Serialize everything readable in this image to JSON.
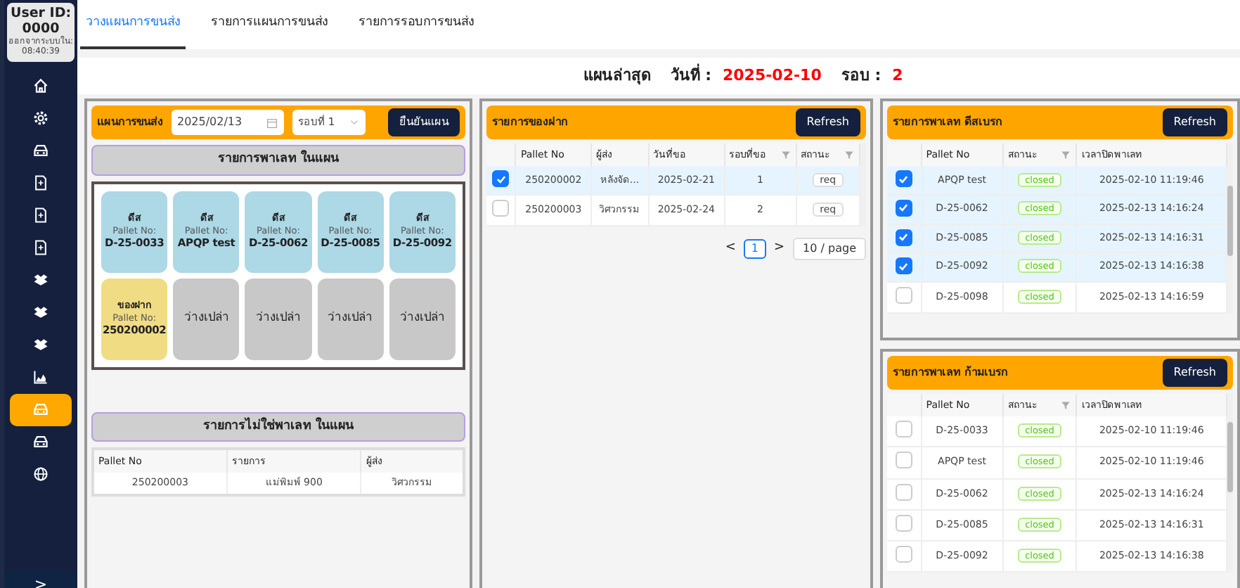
{
  "sidebar": {
    "user_label": "User ID:",
    "user_id": "0000",
    "logout_label": "ออกจากระบบใน:",
    "logout_time": "08:40:39",
    "items": [
      {
        "kind": "home",
        "selected": false
      },
      {
        "kind": "gear",
        "selected": false
      },
      {
        "kind": "car",
        "selected": false
      },
      {
        "kind": "doc",
        "selected": false
      },
      {
        "kind": "doc",
        "selected": false
      },
      {
        "kind": "doc",
        "selected": false
      },
      {
        "kind": "box",
        "selected": false
      },
      {
        "kind": "box",
        "selected": false
      },
      {
        "kind": "box",
        "selected": false
      },
      {
        "kind": "chart",
        "selected": false
      },
      {
        "kind": "car",
        "selected": true
      },
      {
        "kind": "car",
        "selected": false
      },
      {
        "kind": "globe",
        "selected": false
      }
    ],
    "expand": ">"
  },
  "tabs": [
    {
      "label": "วางแผนการขนส่ง",
      "selected": true
    },
    {
      "label": "รายการแผนการขนส่ง",
      "selected": false
    },
    {
      "label": "รายการรอบการขนส่ง",
      "selected": false
    }
  ],
  "header": {
    "label": "แผนล่าสุด",
    "date_label": "วันที่ :",
    "date": "2025-02-10",
    "round_label": "รอบ :",
    "round": "2"
  },
  "plan_panel": {
    "label": "แผนการขนส่ง",
    "date": "2025/02/13",
    "round_select": "รอบที่ 1",
    "confirm_button": "ยืนยันแผน",
    "pallet_title": "รายการพาเลท ในแผน",
    "pallets": [
      {
        "kind": "pallet",
        "type": "ดีส",
        "pallet_label": "Pallet No:",
        "pallet_no": "D-25-0033"
      },
      {
        "kind": "pallet",
        "type": "ดีส",
        "pallet_label": "Pallet No:",
        "pallet_no": "APQP test"
      },
      {
        "kind": "pallet",
        "type": "ดีส",
        "pallet_label": "Pallet No:",
        "pallet_no": "D-25-0062"
      },
      {
        "kind": "pallet",
        "type": "ดีส",
        "pallet_label": "Pallet No:",
        "pallet_no": "D-25-0085"
      },
      {
        "kind": "pallet",
        "type": "ดีส",
        "pallet_label": "Pallet No:",
        "pallet_no": "D-25-0092"
      },
      {
        "kind": "deposit",
        "type": "ของฝาก",
        "pallet_label": "Pallet No:",
        "pallet_no": "250200002"
      },
      {
        "kind": "empty",
        "type": "ว่างเปล่า"
      },
      {
        "kind": "empty",
        "type": "ว่างเปล่า"
      },
      {
        "kind": "empty",
        "type": "ว่างเปล่า"
      },
      {
        "kind": "empty",
        "type": "ว่างเปล่า"
      }
    ],
    "other_title": "รายการไม่ใช่พาเลท ในแผน",
    "other_columns": [
      "Pallet No",
      "รายการ",
      "ผู้ส่ง"
    ],
    "other_rows": [
      [
        "250200003",
        "แม่พิมพ์ 900",
        "วิศวกรรม"
      ]
    ]
  },
  "deposit_panel": {
    "title": "รายการของฝาก",
    "refresh": "Refresh",
    "columns": [
      {
        "label": "Pallet No",
        "filter": false
      },
      {
        "label": "ผู้ส่ง",
        "filter": false
      },
      {
        "label": "วันที่ขอ",
        "filter": false
      },
      {
        "label": "รอบที่ขอ",
        "filter": true
      },
      {
        "label": "สถานะ",
        "filter": true
      }
    ],
    "rows": [
      {
        "selected": true,
        "cells": [
          "250200002",
          "หลังจัด...",
          "2025-02-21",
          "1",
          "req"
        ]
      },
      {
        "selected": false,
        "cells": [
          "250200003",
          "วิศวกรรม",
          "2025-02-24",
          "2",
          "req"
        ]
      }
    ],
    "pagination": {
      "prev": "<",
      "page": "1",
      "next": ">",
      "page_size": "10 / page"
    }
  },
  "pallet_panels": [
    {
      "title": "รายการพาเลท ดีสเบรก",
      "refresh": "Refresh",
      "columns": [
        {
          "label": "Pallet No",
          "filter": false
        },
        {
          "label": "สถานะ",
          "filter": true
        },
        {
          "label": "เวลาปิดพาเลท",
          "filter": false
        }
      ],
      "rows": [
        {
          "selected": true,
          "pallet_no": "APQP test",
          "status": "closed",
          "closed_at": "2025-02-10 11:19:46"
        },
        {
          "selected": true,
          "pallet_no": "D-25-0062",
          "status": "closed",
          "closed_at": "2025-02-13 14:16:24"
        },
        {
          "selected": true,
          "pallet_no": "D-25-0085",
          "status": "closed",
          "closed_at": "2025-02-13 14:16:31"
        },
        {
          "selected": true,
          "pallet_no": "D-25-0092",
          "status": "closed",
          "closed_at": "2025-02-13 14:16:38"
        },
        {
          "selected": false,
          "pallet_no": "D-25-0098",
          "status": "closed",
          "closed_at": "2025-02-13 14:16:59"
        }
      ]
    },
    {
      "title": "รายการพาเลท ก้ามเบรก",
      "refresh": "Refresh",
      "columns": [
        {
          "label": "Pallet No",
          "filter": false
        },
        {
          "label": "สถานะ",
          "filter": true
        },
        {
          "label": "เวลาปิดพาเลท",
          "filter": false
        }
      ],
      "rows": [
        {
          "selected": false,
          "pallet_no": "D-25-0033",
          "status": "closed",
          "closed_at": "2025-02-10 11:19:46"
        },
        {
          "selected": false,
          "pallet_no": "APQP test",
          "status": "closed",
          "closed_at": "2025-02-10 11:19:46"
        },
        {
          "selected": false,
          "pallet_no": "D-25-0062",
          "status": "closed",
          "closed_at": "2025-02-13 14:16:24"
        },
        {
          "selected": false,
          "pallet_no": "D-25-0085",
          "status": "closed",
          "closed_at": "2025-02-13 14:16:31"
        },
        {
          "selected": false,
          "pallet_no": "D-25-0092",
          "status": "closed",
          "closed_at": "2025-02-13 14:16:38"
        }
      ]
    }
  ]
}
